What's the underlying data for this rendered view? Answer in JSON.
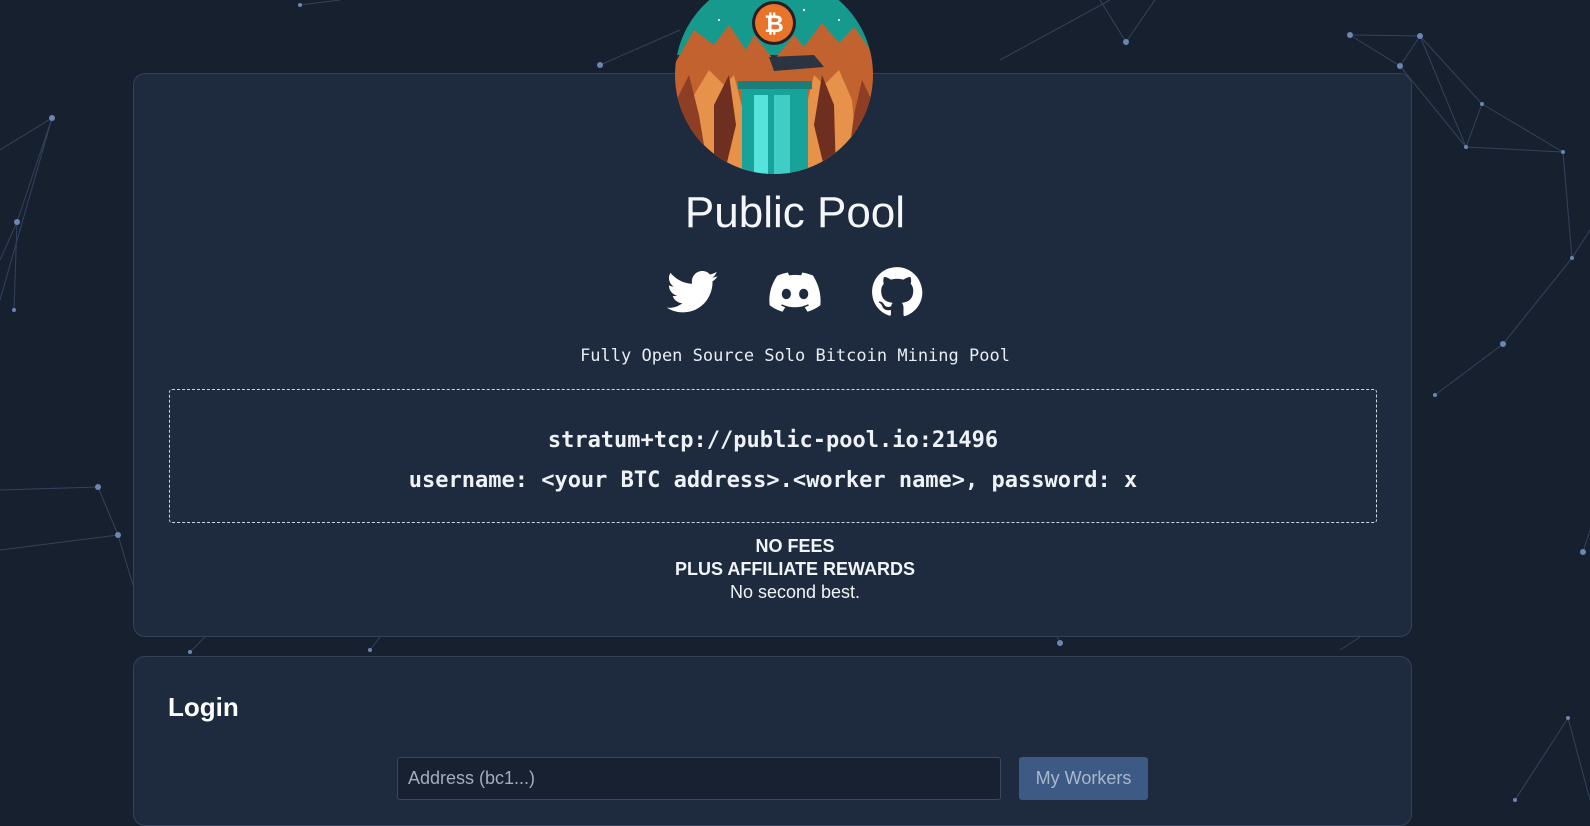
{
  "brand": {
    "title": "Public Pool",
    "tagline": "Fully Open Source Solo Bitcoin Mining Pool"
  },
  "socials": [
    {
      "name": "twitter",
      "icon": "twitter-icon"
    },
    {
      "name": "discord",
      "icon": "discord-icon"
    },
    {
      "name": "github",
      "icon": "github-icon"
    }
  ],
  "connection": {
    "url": "stratum+tcp://public-pool.io:21496",
    "credentials": "username: <your BTC address>.<worker name>, password: x"
  },
  "fees": {
    "line1": "NO FEES",
    "line2": "PLUS AFFILIATE REWARDS",
    "line3": "No second best."
  },
  "login": {
    "title": "Login",
    "address_placeholder": "Address (bc1...)",
    "button_label": "My Workers"
  },
  "colors": {
    "background": "#17202f",
    "card": "#1e2b3e",
    "button": "#3c5a83",
    "bitcoin_orange": "#e8742a"
  }
}
